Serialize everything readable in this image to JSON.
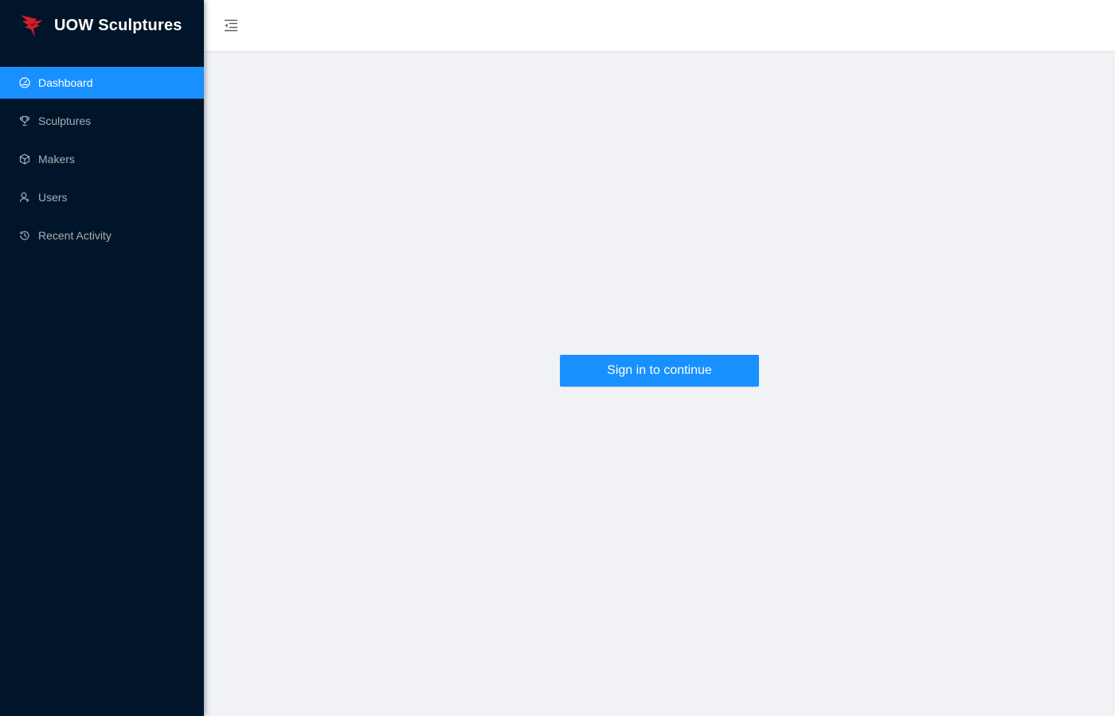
{
  "app": {
    "title": "UOW Sculptures",
    "logo_icon": "uow-bird-logo-icon"
  },
  "colors": {
    "sidebar_bg": "#001529",
    "accent": "#1890ff",
    "content_bg": "#f0f2f5",
    "logo_red": "#d21f26"
  },
  "sidebar": {
    "items": [
      {
        "label": "Dashboard",
        "icon": "dashboard-icon",
        "active": true
      },
      {
        "label": "Sculptures",
        "icon": "trophy-icon",
        "active": false
      },
      {
        "label": "Makers",
        "icon": "code-sandbox-icon",
        "active": false
      },
      {
        "label": "Users",
        "icon": "user-icon",
        "active": false
      },
      {
        "label": "Recent Activity",
        "icon": "history-icon",
        "active": false
      }
    ]
  },
  "header": {
    "trigger_icon": "menu-fold-icon"
  },
  "main": {
    "signin_label": "Sign in to continue"
  }
}
